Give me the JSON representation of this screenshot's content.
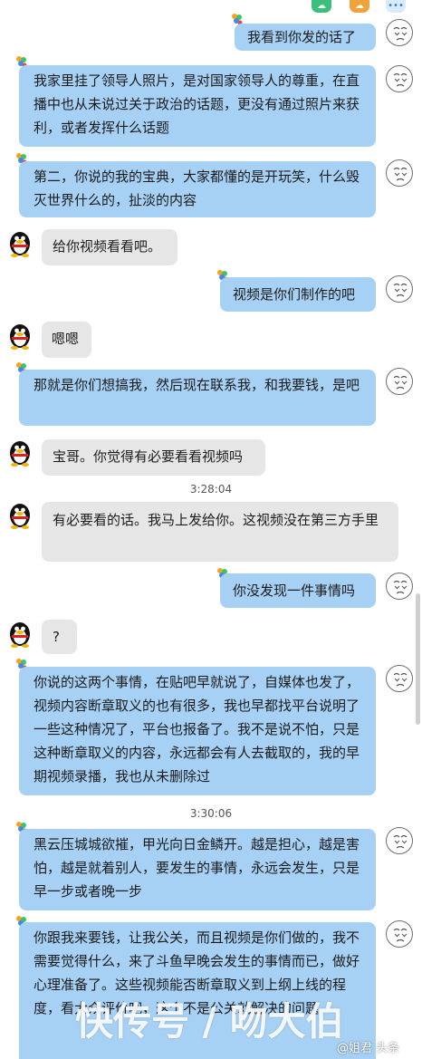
{
  "toolbar": {
    "icon_1": "cloud-icon",
    "icon_2": "cloud-icon",
    "icon_3": "more-icon",
    "more_glyph": "•••"
  },
  "messages": [
    {
      "side": "out",
      "text": "我看到你发的话了"
    },
    {
      "side": "out",
      "text": "我家里挂了领导人照片，是对国家领导人的尊重，在直播中也从未说过关于政治的话题，更没有通过照片来获利，或者发挥什么话题"
    },
    {
      "side": "out",
      "text": "第二，你说的我的宝典，大家都懂的是开玩笑，什么毁灭世界什么的，扯淡的内容"
    },
    {
      "side": "in",
      "text": "给你视频看看吧。"
    },
    {
      "side": "out",
      "text": "视频是你们制作的吧"
    },
    {
      "side": "in",
      "text": "嗯嗯"
    },
    {
      "side": "out",
      "text": "那就是你们想搞我，然后现在联系我，和我要钱，是吧"
    },
    {
      "side": "in",
      "text": "宝哥。你觉得有必要看看视频吗"
    },
    {
      "side": "in",
      "text": "有必要看的话。我马上发给你。这视频没在第三方手里"
    },
    {
      "side": "out",
      "text": "你没发现一件事情吗"
    },
    {
      "side": "in",
      "text": "?"
    },
    {
      "side": "out",
      "text": "你说的这两个事情，在贴吧早就说了，自媒体也发了，视频内容断章取义的也有很多，我也早都找平台说明了一些这种情况了，平台也报备了。我不是说不怕，只是这种断章取义的内容，永远都会有人去截取的，我的早期视频录播，我也从未删除过"
    },
    {
      "side": "out",
      "text": "黑云压城城欲摧，甲光向日金鳞开。越是担心，越是害怕，越是就着别人，要发生的事情，永远会发生，只是早一步或者晚一步"
    },
    {
      "side": "out",
      "text": "你跟我来要钱，让我公关，而且视频是你们做的，我不需要觉得什么，来了斗鱼早晚会发生的事情而已，做好心理准备了。这些视频能否断章取义到上纲上线的程度，看大众评价吧，这个不是公关就解决的问题"
    }
  ],
  "timestamps": [
    "3:28:04",
    "3:30:06"
  ],
  "watermark": {
    "main": "快传号 / 吻大伯",
    "small": "@姐君 头条"
  },
  "colors": {
    "outgoing_bubble": "#a6d1f5",
    "incoming_bubble": "#e6e6e6",
    "page_background": "#ffffff"
  }
}
